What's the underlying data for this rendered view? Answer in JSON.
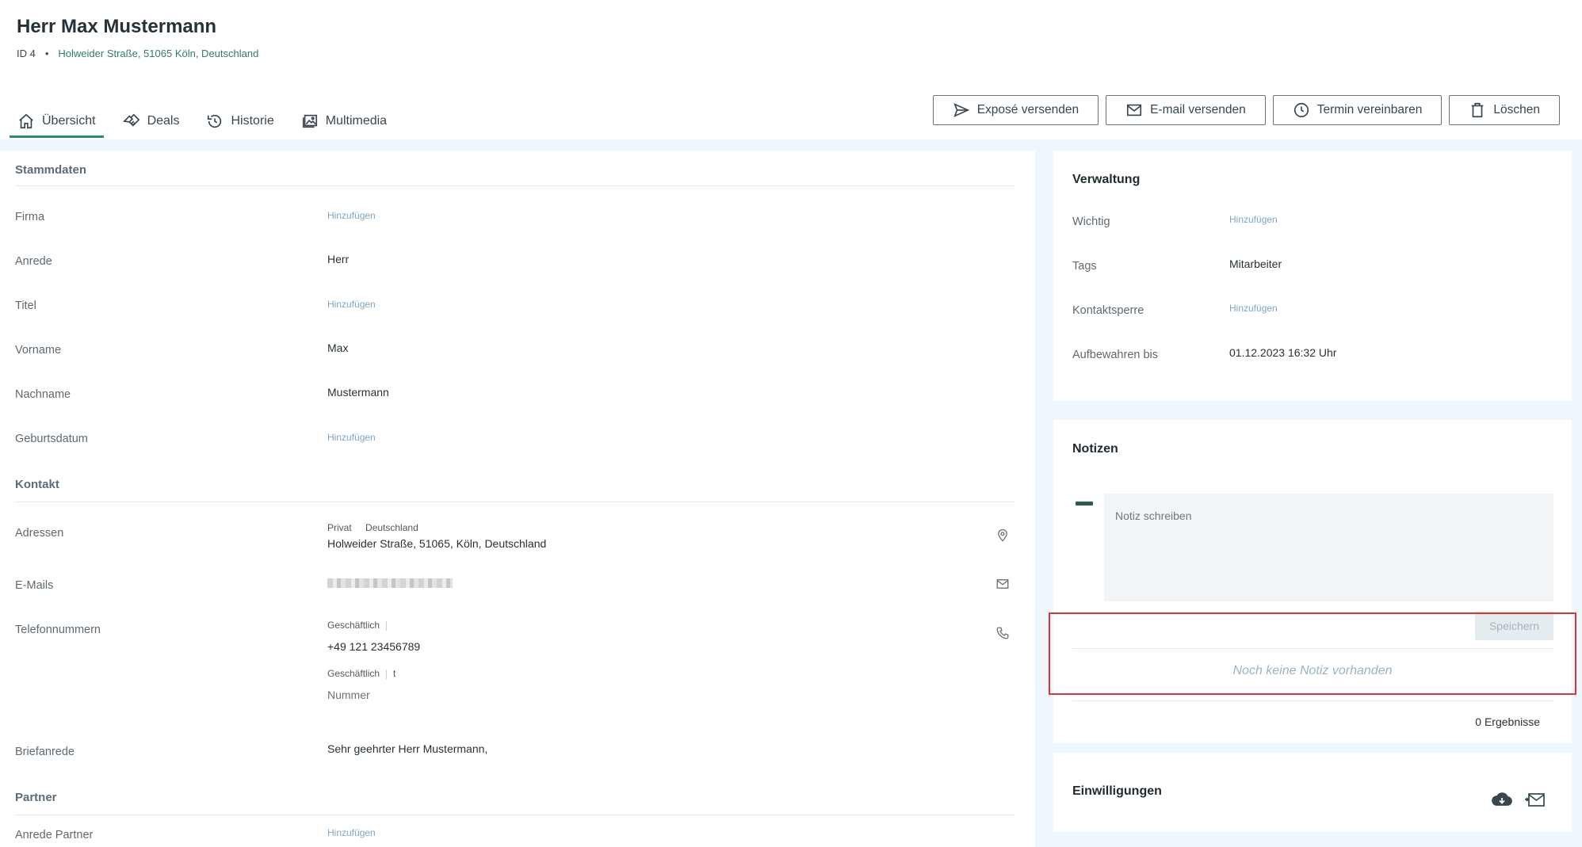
{
  "header": {
    "title": "Herr Max Mustermann",
    "id": "ID 4",
    "separator": "•",
    "address": "Holweider Straße, 51065 Köln, Deutschland"
  },
  "tabs": [
    {
      "label": "Übersicht",
      "icon": "home-icon",
      "active": true
    },
    {
      "label": "Deals",
      "icon": "handshake-icon"
    },
    {
      "label": "Historie",
      "icon": "history-icon"
    },
    {
      "label": "Multimedia",
      "icon": "images-icon"
    }
  ],
  "actions": {
    "expose": "Exposé versenden",
    "email": "E-mail versenden",
    "termin": "Termin vereinbaren",
    "delete": "Löschen"
  },
  "stammdaten": {
    "title": "Stammdaten",
    "firma_label": "Firma",
    "firma_add": "Hinzufügen",
    "anrede_label": "Anrede",
    "anrede_value": "Herr",
    "titel_label": "Titel",
    "titel_add": "Hinzufügen",
    "vorname_label": "Vorname",
    "vorname_value": "Max",
    "nachname_label": "Nachname",
    "nachname_value": "Mustermann",
    "geburtsdatum_label": "Geburtsdatum",
    "geburtsdatum_add": "Hinzufügen"
  },
  "kontakt": {
    "title": "Kontakt",
    "adressen_label": "Adressen",
    "adresse_type": "Privat",
    "adresse_country": "Deutschland",
    "adresse_value": "Holweider Straße, 51065, Köln, Deutschland",
    "emails_label": "E-Mails",
    "telefon_label": "Telefonnummern",
    "phone1_type": "Geschäftlich",
    "phone1_value": "+49 121 23456789",
    "phone2_type": "Geschäftlich",
    "phone2_extra": "t",
    "phone2_value": "Nummer",
    "briefanrede_label": "Briefanrede",
    "briefanrede_value": "Sehr geehrter Herr Mustermann,"
  },
  "partner": {
    "title": "Partner",
    "anrede_label": "Anrede Partner",
    "anrede_add": "Hinzufügen"
  },
  "verwaltung": {
    "title": "Verwaltung",
    "wichtig_label": "Wichtig",
    "wichtig_add": "Hinzufügen",
    "tags_label": "Tags",
    "tags_value": "Mitarbeiter",
    "sperre_label": "Kontaktsperre",
    "sperre_add": "Hinzufügen",
    "aufbewahren_label": "Aufbewahren bis",
    "aufbewahren_value": "01.12.2023 16:32 Uhr"
  },
  "notizen": {
    "title": "Notizen",
    "placeholder": "Notiz schreiben",
    "save": "Speichern",
    "empty": "Noch keine Notiz vorhanden",
    "results": "0 Ergebnisse"
  },
  "einwilligungen": {
    "title": "Einwilligungen"
  },
  "colors": {
    "accent": "#2e8b6e",
    "link": "#2e7d6b",
    "add": "#7fa7c4",
    "highlight": "#d9343c",
    "background": "#eef6fb"
  }
}
